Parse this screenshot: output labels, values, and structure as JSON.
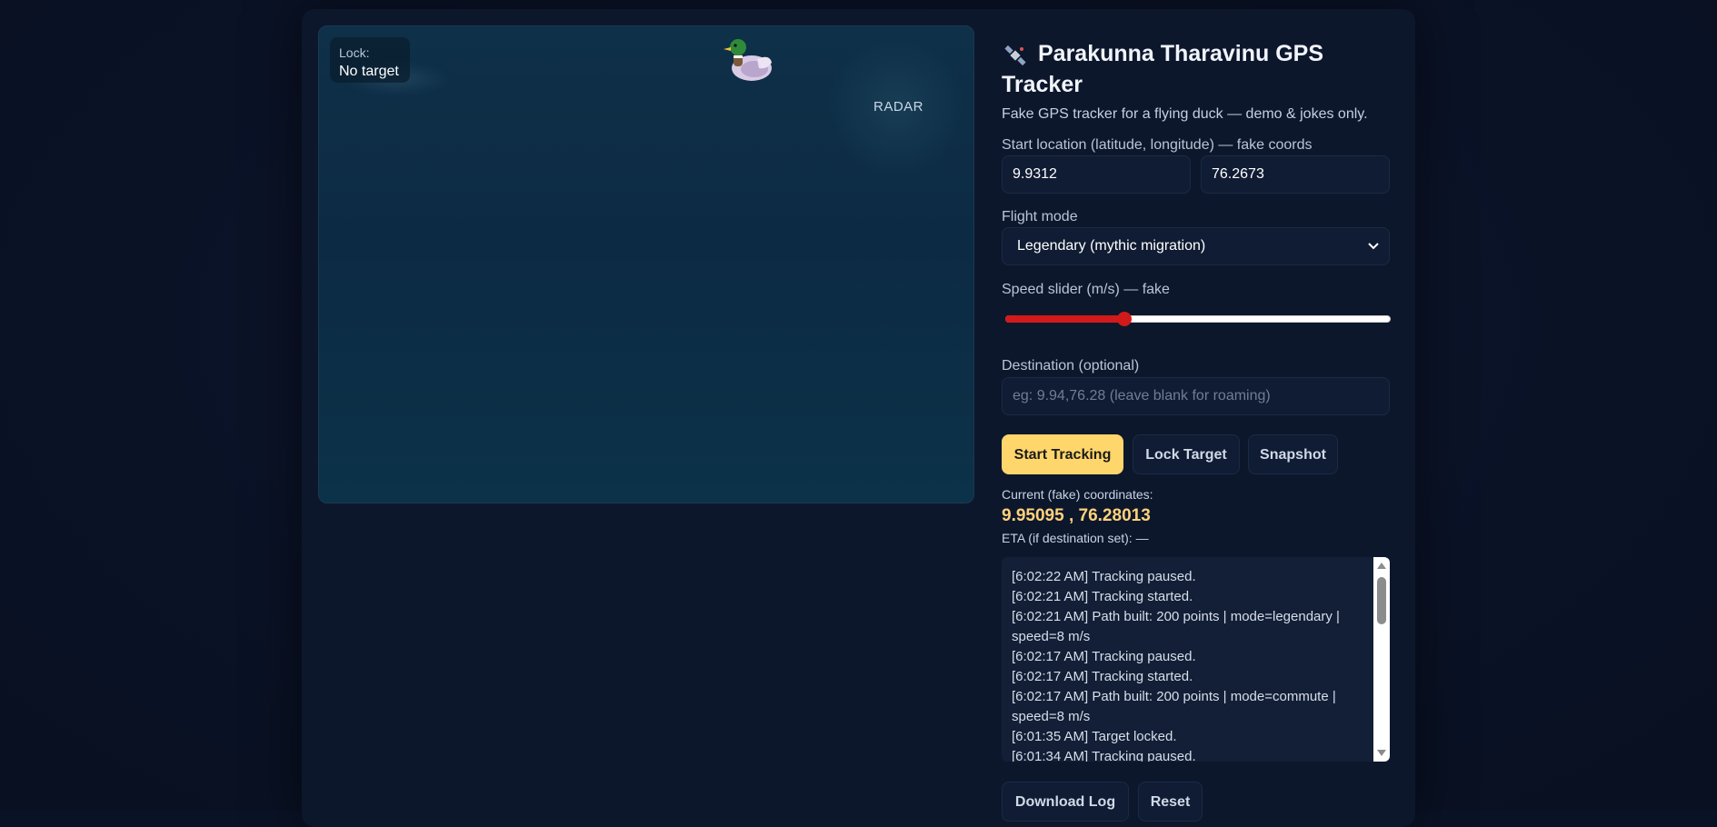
{
  "map": {
    "lock_label": "Lock:",
    "lock_value": "No target",
    "radar_label": "RADAR",
    "duck_icon": "duck-icon"
  },
  "sidebar": {
    "title_icon": "satellite-icon",
    "title": "Parakunna Tharavinu GPS Tracker",
    "subtitle": "Fake GPS tracker for a flying duck — demo & jokes only.",
    "start_label": "Start location (latitude, longitude) — fake coords",
    "start_lat": "9.9312",
    "start_lng": "76.2673",
    "flight_mode_label": "Flight mode",
    "flight_mode_value": "Legendary (mythic migration)",
    "speed_label": "Speed slider (m/s) — fake",
    "speed_fraction": 0.31,
    "destination_label": "Destination (optional)",
    "destination_placeholder": "eg: 9.94,76.28 (leave blank for roaming)",
    "buttons": {
      "start": "Start Tracking",
      "lock": "Lock Target",
      "snapshot": "Snapshot",
      "download": "Download Log",
      "reset": "Reset"
    },
    "coords_label": "Current (fake) coordinates:",
    "coords_value": "9.95095 , 76.28013",
    "eta": "ETA (if destination set): —",
    "log": [
      "[6:02:22 AM] Tracking paused.",
      "[6:02:21 AM] Tracking started.",
      "[6:02:21 AM] Path built: 200 points | mode=legendary | speed=8 m/s",
      "[6:02:17 AM] Tracking paused.",
      "[6:02:17 AM] Tracking started.",
      "[6:02:17 AM] Path built: 200 points | mode=commute | speed=8 m/s",
      "[6:01:35 AM] Target locked.",
      "[6:01:34 AM] Tracking paused."
    ]
  },
  "colors": {
    "accent": "#ffd66b",
    "slider": "#d21a1a",
    "coords": "#ffd27a",
    "background": "#0a1226"
  }
}
